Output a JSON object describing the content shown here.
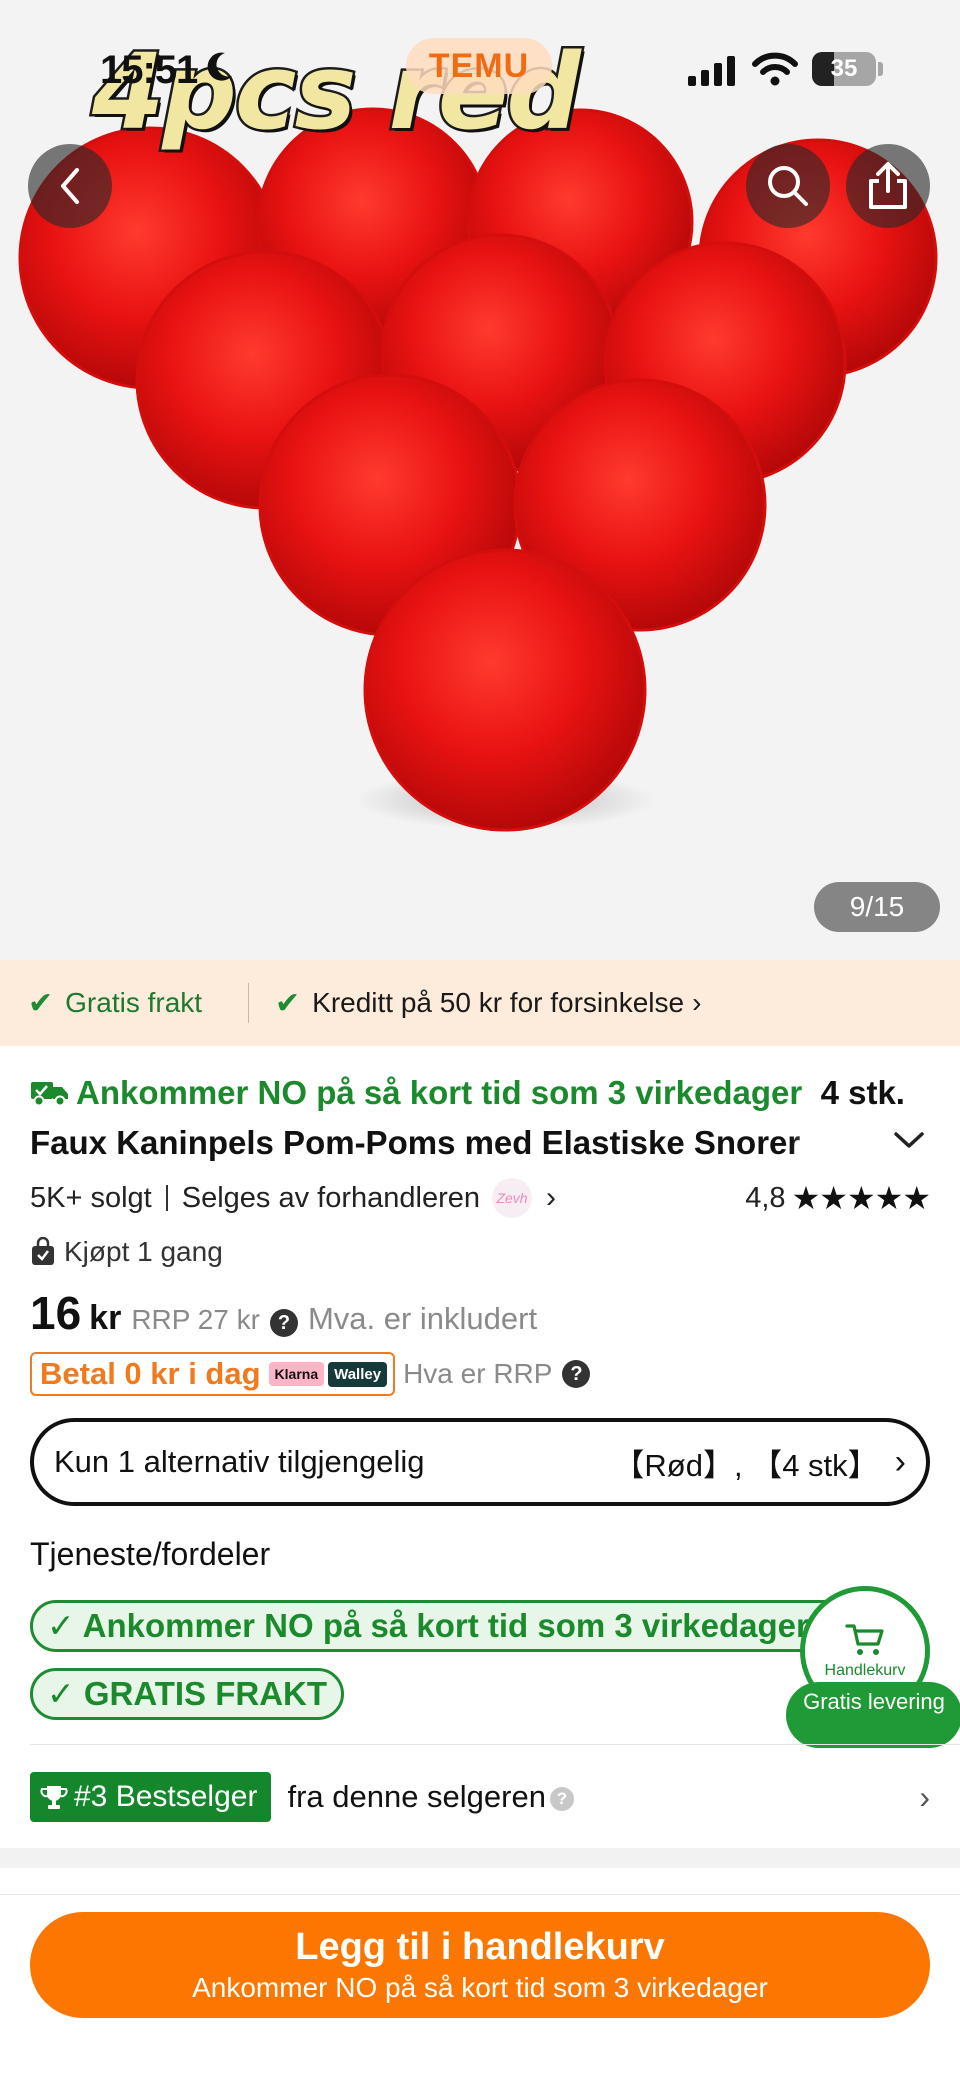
{
  "status_bar": {
    "time": "15:51",
    "battery": "35",
    "battery_level": 0.35
  },
  "brand": "TEMU",
  "image": {
    "overlay_text": "4pcs red",
    "counter": "9/15",
    "pom_color": "#e81212"
  },
  "promo": {
    "free_shipping": "Gratis frakt",
    "credit": "Kreditt på 50 kr for forsinkelse"
  },
  "product": {
    "delivery_headline": "Ankommer NO på så kort tid som 3 virkedager",
    "title": "4 stk. Faux Kaninpels Pom-Poms med Elastiske Snorer",
    "sold": "5K+ solgt",
    "seller": "Selges av forhandleren",
    "seller_logo_text": "Zevh",
    "rating": "4,8",
    "stars": "★★★★★",
    "bought": "Kjøpt 1 gang"
  },
  "price": {
    "amount": "16",
    "currency": "kr",
    "rrp": "RRP 27 kr",
    "vat": "Mva. er inkludert",
    "pay_today": "Betal 0 kr i dag",
    "klarna": "Klarna",
    "walley": "Walley",
    "rrp_help": "Hva er RRP"
  },
  "variant": {
    "label": "Kun 1 alternativ tilgjengelig",
    "value": "【Rød】, 【4 stk】"
  },
  "services": {
    "title": "Tjeneste/fordeler",
    "items": [
      "Ankommer NO på så kort tid som 3 virkedager",
      "GRATIS FRAKT"
    ]
  },
  "cart_float": {
    "label": "Handlekurv",
    "free_delivery": "Gratis levering"
  },
  "bestseller": {
    "badge": "#3 Bestselger",
    "text": "fra denne selgeren"
  },
  "cta": {
    "label": "Legg til i handlekurv",
    "sub": "Ankommer NO på så kort tid som 3 virkedager"
  },
  "colors": {
    "accent_orange": "#fb7701",
    "green": "#1f8b33"
  }
}
